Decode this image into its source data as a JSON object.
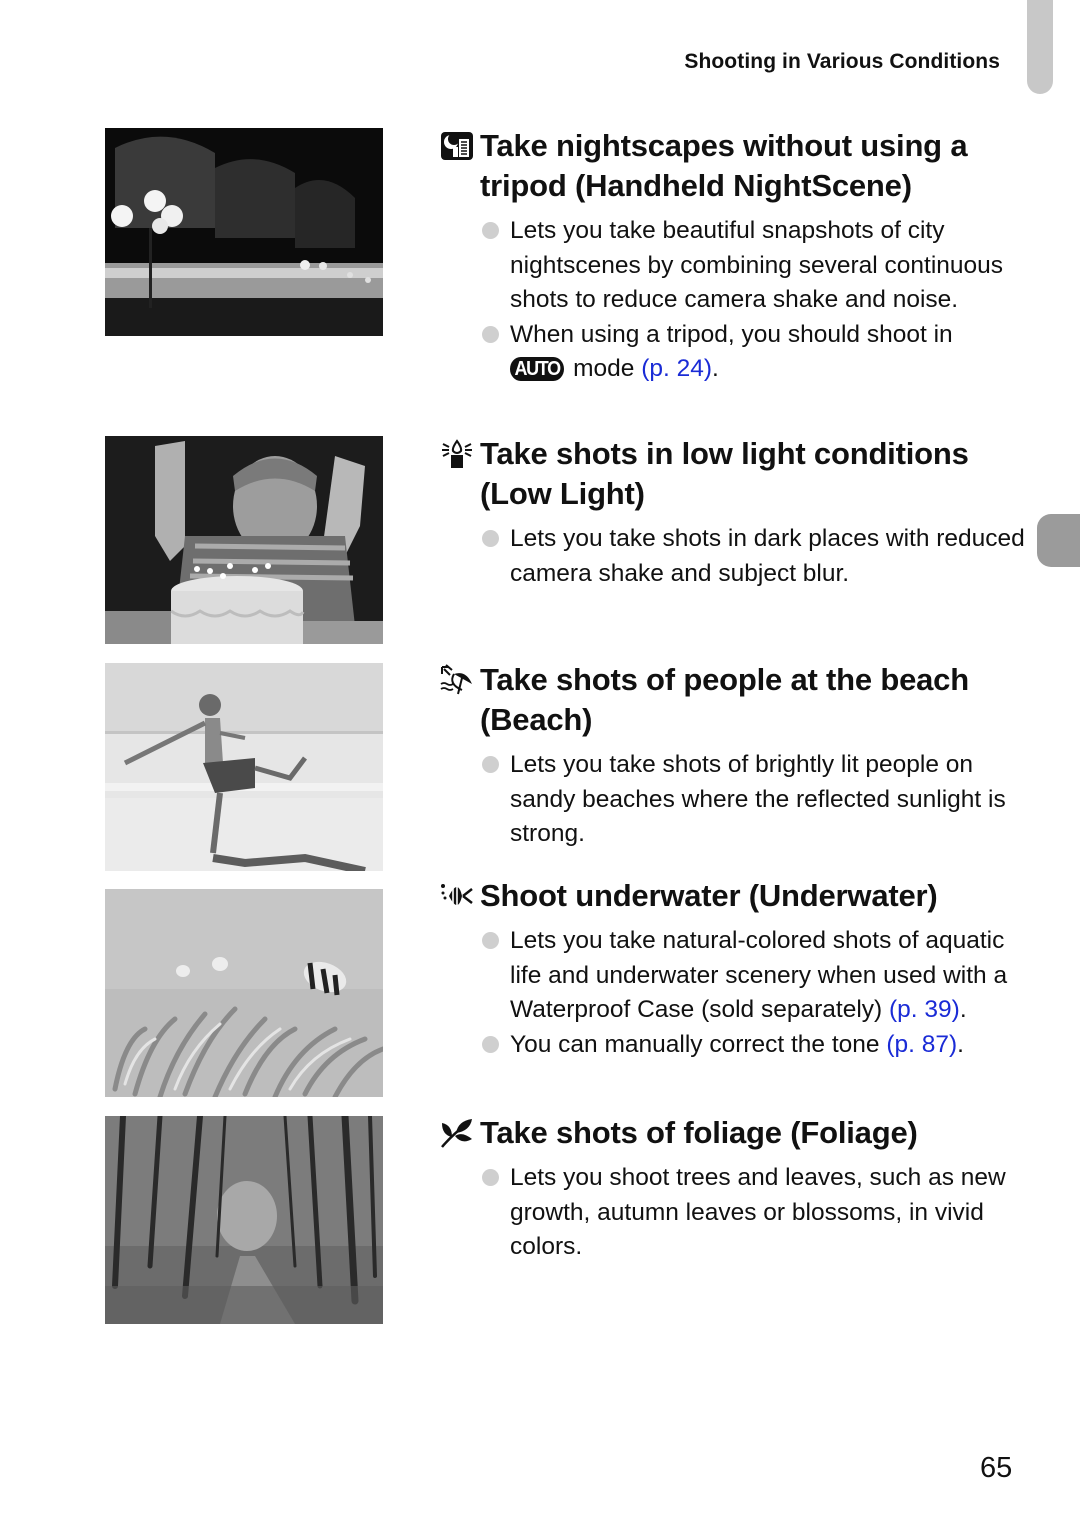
{
  "header": {
    "running_title": "Shooting in Various Conditions"
  },
  "page_number": "65",
  "colors": {
    "link": "#1a2bd6",
    "bullet": "#cfcfcf",
    "tab_top": "#c8c8c8",
    "tab_side": "#9b9b9b"
  },
  "sections": [
    {
      "icon": "handheld-nightscene-icon",
      "photo": "night-street-lamps-photo",
      "heading": "Take nightscapes without using a tripod (Handheld NightScene)",
      "bullets": [
        {
          "text": "Lets you take beautiful snapshots of city nightscenes by combining several continuous shots to reduce camera shake and noise."
        },
        {
          "pre": "When using a tripod, you should shoot in",
          "badge": "AUTO",
          "post": " mode ",
          "link": "(p. 24)",
          "end": "."
        }
      ]
    },
    {
      "icon": "low-light-candle-icon",
      "photo": "birthday-cake-child-photo",
      "heading": "Take shots in low light conditions (Low Light)",
      "bullets": [
        {
          "text": "Lets you take shots in dark places with reduced camera shake and subject blur."
        }
      ]
    },
    {
      "icon": "beach-umbrella-icon",
      "photo": "boy-kicking-on-beach-photo",
      "heading": "Take shots of people at the beach (Beach)",
      "bullets": [
        {
          "text": "Lets you take shots of brightly lit people on sandy beaches where the reflected sunlight is strong."
        }
      ]
    },
    {
      "icon": "underwater-fish-icon",
      "photo": "clownfish-anemone-photo",
      "heading": "Shoot underwater (Underwater)",
      "bullets": [
        {
          "pre": "Lets you take natural-colored shots of aquatic life and underwater scenery when used with a Waterproof Case (sold separately) ",
          "link": "(p. 39)",
          "end": "."
        },
        {
          "pre": "You can manually correct the tone ",
          "link": "(p. 87)",
          "end": "."
        }
      ]
    },
    {
      "icon": "foliage-leaf-icon",
      "photo": "forest-path-photo",
      "heading": "Take shots of foliage (Foliage)",
      "bullets": [
        {
          "text": "Lets you shoot trees and leaves, such as new growth, autumn leaves or blossoms, in vivid colors."
        }
      ]
    }
  ]
}
